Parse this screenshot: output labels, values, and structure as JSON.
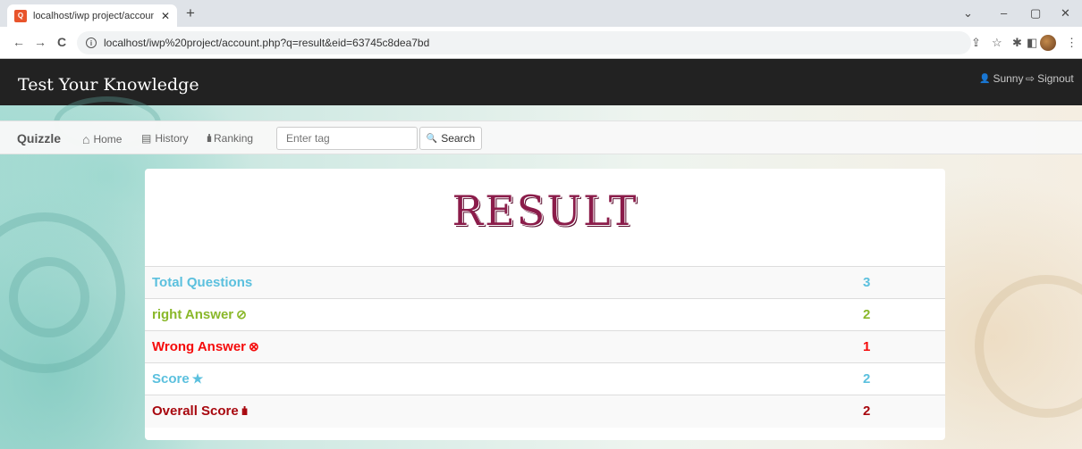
{
  "browser": {
    "tab_title": "localhost/iwp project/account.ph",
    "favicon_text": "Q",
    "close_glyph": "✕",
    "new_tab_glyph": "+",
    "url": "localhost/iwp%20project/account.php?q=result&eid=63745c8dea7bd",
    "window_controls": [
      "⌄",
      "–",
      "▢",
      "✕"
    ],
    "nav_glyphs": {
      "back": "←",
      "forward": "→",
      "reload": "C"
    },
    "toolbar_glyphs": {
      "share": "⇪",
      "star": "☆",
      "extensions": "✱",
      "sidepanel": "◧",
      "menu": "⋮"
    }
  },
  "header": {
    "title": "Test Your Knowledge",
    "user_label": "Sunny",
    "user_icon": "👤",
    "signout_label": "Signout",
    "signout_icon": "⇨"
  },
  "quiz_nav": {
    "brand": "Quizzle",
    "home_label": "Home",
    "home_icon": "⌂",
    "history_label": "History",
    "history_icon": "▤",
    "ranking_label": "Ranking",
    "ranking_icon": "ılı",
    "search_placeholder": "Enter tag",
    "search_button_label": "Search",
    "search_icon": "🔍"
  },
  "result": {
    "title": "RESULT",
    "rows": [
      {
        "label": "Total Questions",
        "icon": "",
        "value": "3",
        "color": "#5bc0de"
      },
      {
        "label": "right Answer",
        "icon": "⊘",
        "value": "2",
        "color": "#8ab82a"
      },
      {
        "label": "Wrong Answer",
        "icon": "⊗",
        "value": "1",
        "color": "#f50b0b"
      },
      {
        "label": "Score",
        "icon": "★",
        "value": "2",
        "color": "#5bc0de"
      },
      {
        "label": "Overall Score",
        "icon": "ılı",
        "value": "2",
        "color": "#a8080f"
      }
    ]
  }
}
